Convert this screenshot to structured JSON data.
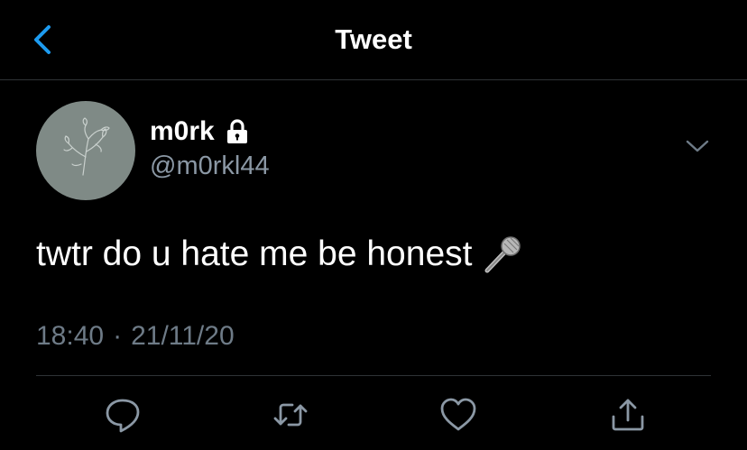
{
  "header": {
    "title": "Tweet"
  },
  "author": {
    "display_name": "m0rk",
    "username": "@m0rkl44",
    "protected": true
  },
  "tweet": {
    "text": "twtr do u hate me be honest",
    "emoji": "microphone",
    "time": "18:40",
    "separator": "·",
    "date": "21/11/20"
  },
  "icons": {
    "back": "chevron-left-icon",
    "lock": "lock-icon",
    "more": "chevron-down-icon",
    "emoji": "microphone-icon",
    "reply": "reply-icon",
    "retweet": "retweet-icon",
    "like": "heart-icon",
    "share": "share-icon"
  },
  "colors": {
    "background": "#000000",
    "accent": "#1d9bf0",
    "text_primary": "#ffffff",
    "text_secondary": "#8b98a5",
    "divider": "#2f3336",
    "avatar_bg": "#7f8a86"
  }
}
